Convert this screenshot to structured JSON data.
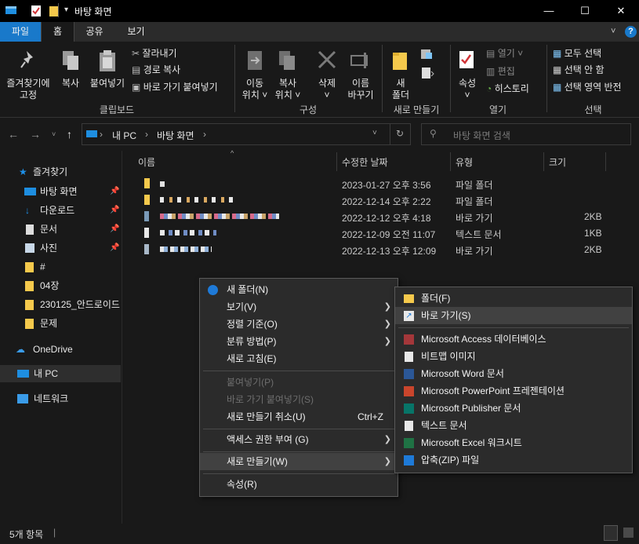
{
  "window": {
    "title": "바탕 화면",
    "minimize": "—",
    "maximize": "☐",
    "close": "✕"
  },
  "tabs": [
    "파일",
    "홈",
    "공유",
    "보기"
  ],
  "ribbon": {
    "pin_quick": "즐겨찾기에\n고정",
    "copy": "복사",
    "paste": "붙여넣기",
    "cut": "잘라내기",
    "copy_path": "경로 복사",
    "paste_shortcut": "바로 가기 붙여넣기",
    "clipboard_label": "클립보드",
    "move_to": "이동\n위치 ˅",
    "copy_to": "복사\n위치 ˅",
    "delete": "삭제",
    "delete_arrow": "˅",
    "rename": "이름\n바꾸기",
    "organize_label": "구성",
    "new_folder": "새\n폴더",
    "new_label": "새로 만들기",
    "properties": "속성",
    "properties_arrow": "˅",
    "open": "열기",
    "edit": "편집",
    "history": "히스토리",
    "open_label": "열기",
    "select_all": "모두 선택",
    "select_none": "선택 안 함",
    "invert_selection": "선택 영역 반전",
    "select_label": "선택"
  },
  "address": {
    "path": [
      "내 PC",
      "바탕 화면"
    ],
    "search_placeholder": "바탕 화면 검색"
  },
  "sidebar": {
    "quick_access": "즐겨찾기",
    "items": [
      "바탕 화면",
      "다운로드",
      "문서",
      "사진",
      "#",
      "04장",
      "230125_안드로이드",
      "문제"
    ],
    "onedrive": "OneDrive",
    "this_pc": "내 PC",
    "network": "네트워크"
  },
  "columns": [
    "이름",
    "수정한 날짜",
    "유형",
    "크기"
  ],
  "files": [
    {
      "date": "2023-01-27 오후 3:56",
      "type": "파일 폴더",
      "size": ""
    },
    {
      "date": "2022-12-14 오후 2:22",
      "type": "파일 폴더",
      "size": ""
    },
    {
      "date": "2022-12-12 오후 4:18",
      "type": "바로 가기",
      "size": "2KB"
    },
    {
      "date": "2022-12-09 오전 11:07",
      "type": "텍스트 문서",
      "size": "1KB"
    },
    {
      "date": "2022-12-13 오후 12:09",
      "type": "바로 가기",
      "size": "2KB"
    }
  ],
  "status": "5개 항목",
  "context_menu": {
    "new_folder": "새 폴더(N)",
    "view": "보기(V)",
    "sort_by": "정렬 기준(O)",
    "group_by": "분류 방법(P)",
    "refresh": "새로 고침(E)",
    "paste": "붙여넣기(P)",
    "paste_shortcut": "바로 가기 붙여넣기(S)",
    "undo_new": "새로 만들기 취소(U)",
    "undo_shortcut": "Ctrl+Z",
    "give_access": "액세스 권한 부여 (G)",
    "new": "새로 만들기(W)",
    "properties": "속성(R)"
  },
  "new_submenu": [
    "폴더(F)",
    "바로 가기(S)",
    "Microsoft Access 데이터베이스",
    "비트맵 이미지",
    "Microsoft Word 문서",
    "Microsoft PowerPoint 프레젠테이션",
    "Microsoft Publisher 문서",
    "텍스트 문서",
    "Microsoft Excel 워크시트",
    "압축(ZIP) 파일"
  ]
}
